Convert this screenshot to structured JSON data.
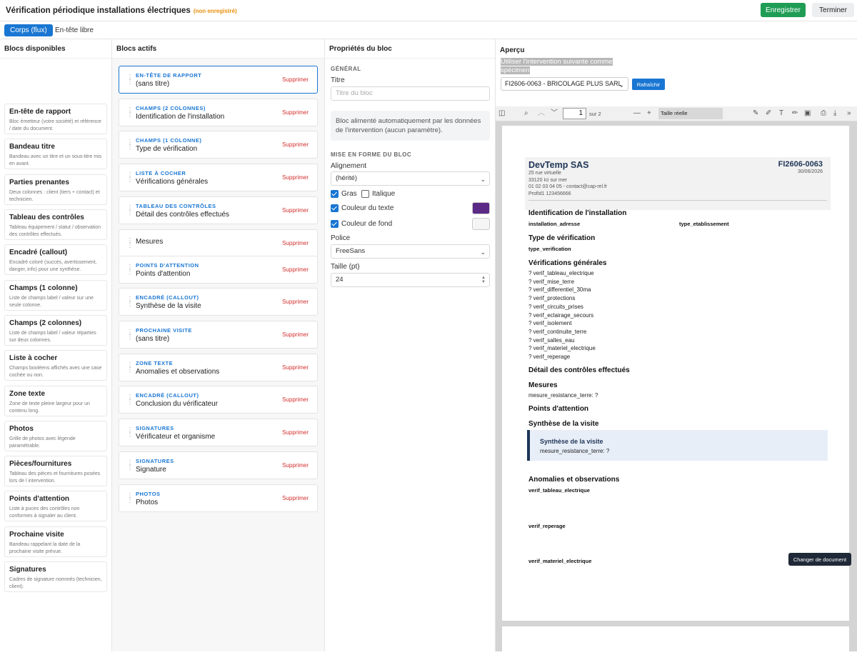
{
  "header": {
    "title": "Vérification périodique installations électriques",
    "unsaved": "(non enregistré)",
    "save": "Enregistrer",
    "done": "Terminer"
  },
  "tabs": {
    "flow": "Corps (flux)",
    "free": "En-tête libre"
  },
  "available": {
    "title": "Blocs disponibles",
    "items": [
      {
        "t": "En-tête de rapport",
        "d": "Bloc émetteur (votre société) et référence / date du document."
      },
      {
        "t": "Bandeau titre",
        "d": "Bandeau avec un titre et un sous-titre mis en avant."
      },
      {
        "t": "Parties prenantes",
        "d": "Deux colonnes : client (tiers + contact) et technicien."
      },
      {
        "t": "Tableau des contrôles",
        "d": "Tableau équipement / statut / observation des contrôles effectués."
      },
      {
        "t": "Encadré (callout)",
        "d": "Encadré coloré (succès, avertissement, danger, info) pour une synthèse."
      },
      {
        "t": "Champs (1 colonne)",
        "d": "Liste de champs label / valeur sur une seule colonne."
      },
      {
        "t": "Champs (2 colonnes)",
        "d": "Liste de champs label / valeur réparties sur deux colonnes."
      },
      {
        "t": "Liste à cocher",
        "d": "Champs booléens affichés avec une case cochée ou non."
      },
      {
        "t": "Zone texte",
        "d": "Zone de texte pleine largeur pour un contenu long."
      },
      {
        "t": "Photos",
        "d": "Grille de photos avec légende paramétrable."
      },
      {
        "t": "Pièces/fournitures",
        "d": "Tableau des pièces et fournitures posées lors de l intervention."
      },
      {
        "t": "Points d'attention",
        "d": "Liste à puces des contrôles non conformes à signaler au client."
      },
      {
        "t": "Prochaine visite",
        "d": "Bandeau rappelant la date de la prochaine visite prévue."
      },
      {
        "t": "Signatures",
        "d": "Cadres de signature nommés (technicien, client)."
      }
    ]
  },
  "active": {
    "title": "Blocs actifs",
    "delete": "Supprimer",
    "items": [
      {
        "kind": "EN-TÊTE DE RAPPORT",
        "name": "(sans titre)"
      },
      {
        "kind": "CHAMPS (2 COLONNES)",
        "name": "Identification de l'installation"
      },
      {
        "kind": "CHAMPS (1 COLONNE)",
        "name": "Type de vérification"
      },
      {
        "kind": "LISTE À COCHER",
        "name": "Vérifications générales"
      },
      {
        "kind": "TABLEAU DES CONTRÔLES",
        "name": "Détail des contrôles effectués"
      },
      {
        "kind": "",
        "name": "Mesures"
      },
      {
        "kind": "POINTS D'ATTENTION",
        "name": "Points d'attention"
      },
      {
        "kind": "ENCADRÉ (CALLOUT)",
        "name": "Synthèse de la visite"
      },
      {
        "kind": "PROCHAINE VISITE",
        "name": "(sans titre)"
      },
      {
        "kind": "ZONE TEXTE",
        "name": "Anomalies et observations"
      },
      {
        "kind": "ENCADRÉ (CALLOUT)",
        "name": "Conclusion du vérificateur"
      },
      {
        "kind": "SIGNATURES",
        "name": "Vérificateur et organisme"
      },
      {
        "kind": "SIGNATURES",
        "name": "Signature"
      },
      {
        "kind": "PHOTOS",
        "name": "Photos"
      }
    ]
  },
  "props": {
    "title": "Propriétés du bloc",
    "general": "GÉNÉRAL",
    "titre_label": "Titre",
    "titre_placeholder": "Titre du bloc",
    "info": "Bloc alimenté automatiquement par les données de l'intervention (aucun paramètre).",
    "format": "MISE EN FORME DU BLOC",
    "align_label": "Alignement",
    "align_value": "(hérité)",
    "bold": "Gras",
    "italic": "Italique",
    "text_color": "Couleur du texte",
    "bg_color": "Couleur de fond",
    "font_label": "Police",
    "font_value": "FreeSans",
    "size_label": "Taille (pt)",
    "size_value": "24",
    "text_color_hex": "#5b2a86",
    "bg_color_hex": "#f5f5f5"
  },
  "preview": {
    "title": "Aperçu",
    "hint": "Utiliser l'intervention suivante comme spécimen",
    "intervention": "FI2606-0063 - BRICOLAGE PLUS SARL",
    "refresh": "Rafraîchir",
    "page_num": "1",
    "page_total": "sur 2",
    "zoom": "Taille réelle",
    "change_doc": "Changer de document"
  },
  "doc": {
    "company": "DevTemp SAS",
    "addr1": "25 rue virtuelle",
    "addr2": "33120 Ici sur mer",
    "contact": "01 02 03 04 05 - contact@cap-rel.fr",
    "profid": "ProfId1 123456666",
    "ref": "FI2606-0063",
    "date": "30/06/2026",
    "h_ident": "Identification de l'installation",
    "f_adresse": "installation_adresse",
    "f_etab": "type_etablissement",
    "h_type": "Type de vérification",
    "f_type": "type_verification",
    "h_verif": "Vérifications générales",
    "checks": [
      "? verif_tableau_electrique",
      "? verif_mise_terre",
      "? verif_differentiel_30ma",
      "? verif_protections",
      "? verif_circuits_prises",
      "? verif_eclairage_secours",
      "? verif_isolement",
      "? verif_continuite_terre",
      "? verif_salles_eau",
      "? verif_materiel_electrique",
      "? verif_reperage"
    ],
    "h_detail": "Détail des contrôles effectués",
    "h_mesures": "Mesures",
    "mesure": "mesure_resistance_terre:  ?",
    "h_points": "Points d'attention",
    "h_synth": "Synthèse de la visite",
    "callout_title": "Synthèse de la visite",
    "callout_val": "mesure_resistance_terre:  ?",
    "h_anom": "Anomalies et observations",
    "anom1": "verif_tableau_electrique",
    "anom2": "verif_reperage",
    "anom3": "verif_materiel_electrique"
  }
}
